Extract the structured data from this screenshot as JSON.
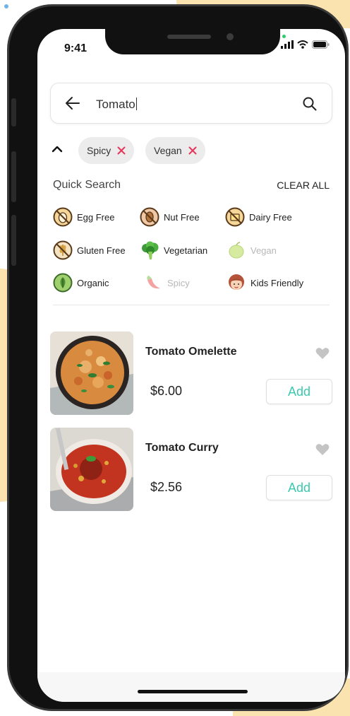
{
  "status_bar": {
    "time": "9:41"
  },
  "search": {
    "value": "Tomato"
  },
  "filters": {
    "chips": [
      {
        "label": "Spicy"
      },
      {
        "label": "Vegan"
      }
    ]
  },
  "quick_search": {
    "title": "Quick Search",
    "clear_all": "CLEAR ALL",
    "options": [
      {
        "label": "Egg Free",
        "icon": "no-egg-icon",
        "muted": false
      },
      {
        "label": "Nut Free",
        "icon": "no-nut-icon",
        "muted": false
      },
      {
        "label": "Dairy Free",
        "icon": "no-dairy-icon",
        "muted": false
      },
      {
        "label": "Gluten Free",
        "icon": "no-gluten-icon",
        "muted": false
      },
      {
        "label": "Vegetarian",
        "icon": "broccoli-icon",
        "muted": false
      },
      {
        "label": "Vegan",
        "icon": "apple-icon",
        "muted": true
      },
      {
        "label": "Organic",
        "icon": "organic-leaf-icon",
        "muted": false
      },
      {
        "label": "Spicy",
        "icon": "chili-pepper-icon",
        "muted": true
      },
      {
        "label": "Kids Friendly",
        "icon": "child-face-icon",
        "muted": false
      }
    ]
  },
  "results": [
    {
      "name": "Tomato Omelette",
      "price": "$6.00",
      "add_label": "Add",
      "favorite": false
    },
    {
      "name": "Tomato Curry",
      "price": "$2.56",
      "add_label": "Add",
      "favorite": false
    }
  ],
  "colors": {
    "accent": "#3cc9ae",
    "remove": "#e8365a",
    "heart": "#c4c4c4",
    "muted_text": "#b8b8b8"
  }
}
